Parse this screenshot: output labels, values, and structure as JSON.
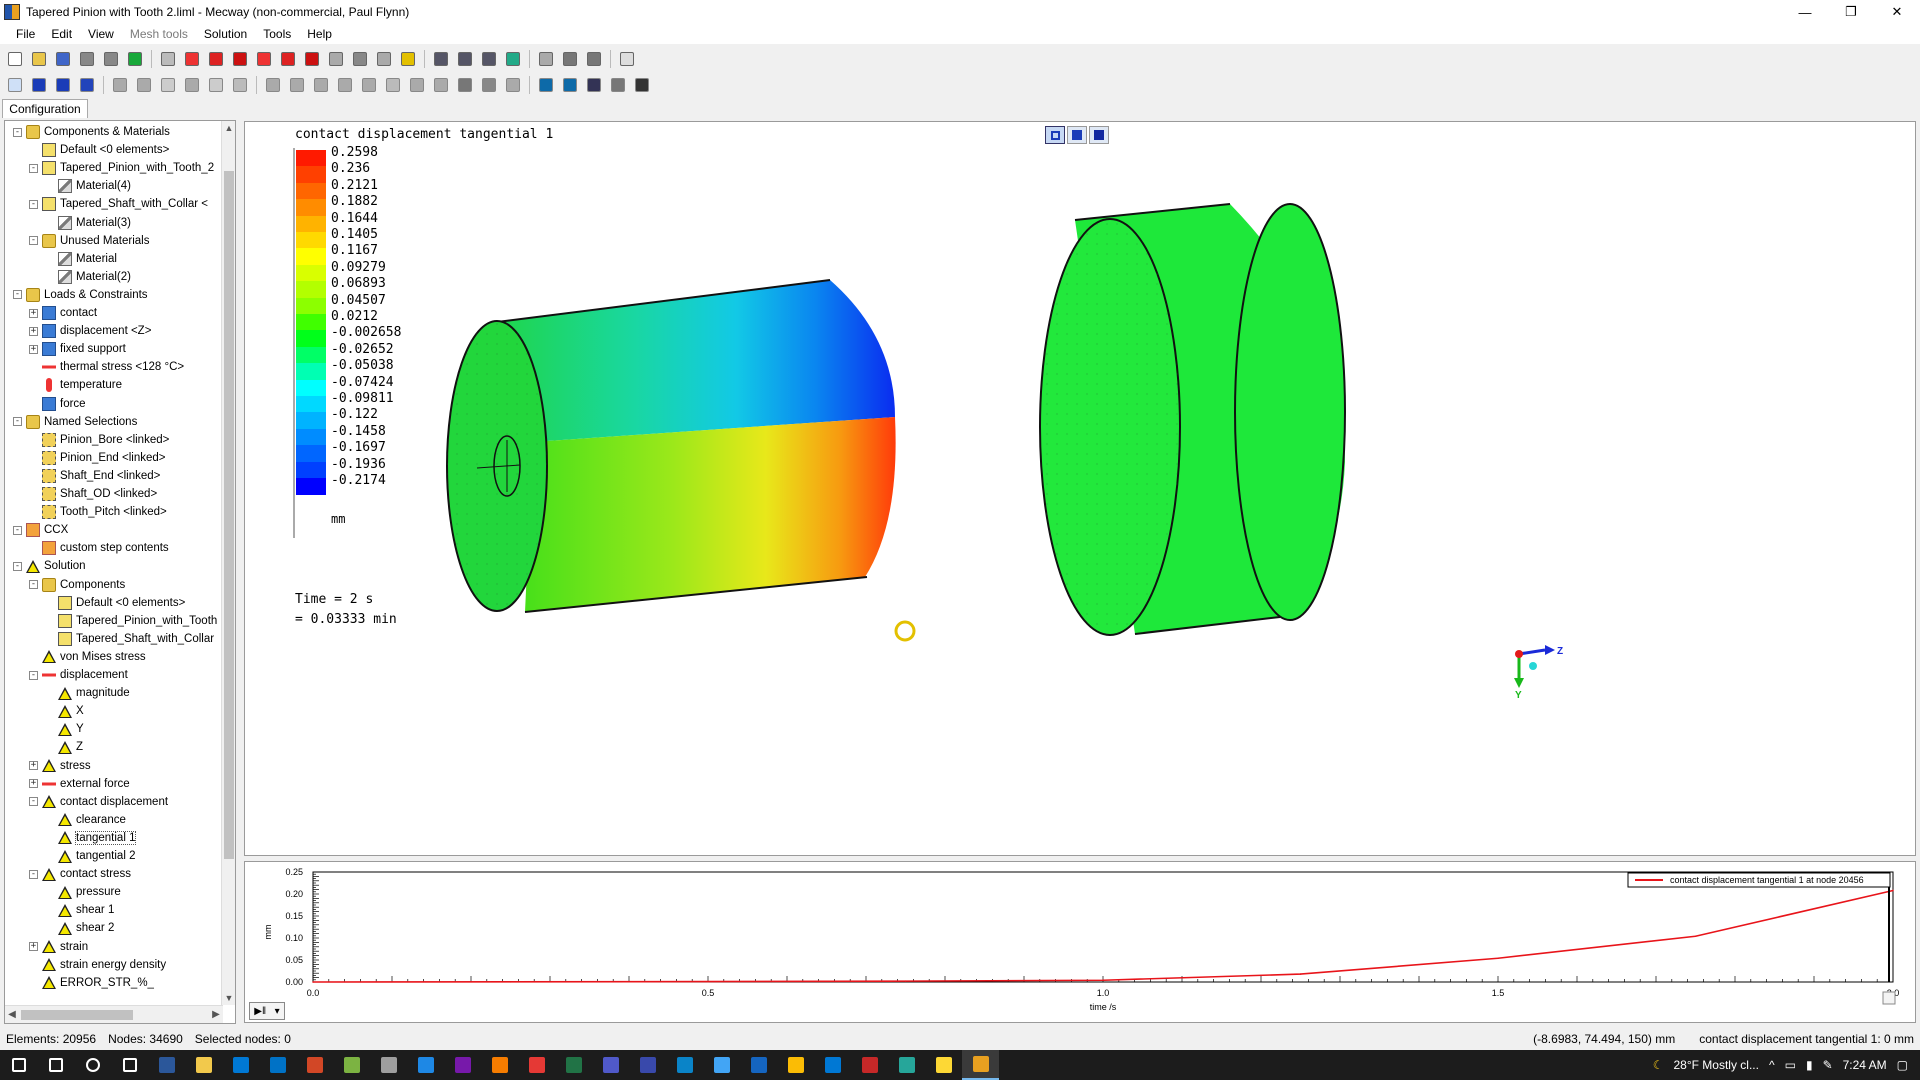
{
  "window": {
    "title": "Tapered Pinion with Tooth 2.liml - Mecway (non-commercial, Paul Flynn)",
    "minimize": "—",
    "maximize": "❐",
    "close": "✕"
  },
  "menu": [
    "File",
    "Edit",
    "View",
    "Mesh tools",
    "Solution",
    "Tools",
    "Help"
  ],
  "menu_disabled": [
    "Mesh tools"
  ],
  "config_tab": "Configuration",
  "tree": [
    {
      "label": "Components & Materials",
      "depth": 0,
      "expander": "-",
      "icon": "folder"
    },
    {
      "label": "Default <0 elements>",
      "depth": 1,
      "expander": "",
      "icon": "comp"
    },
    {
      "label": "Tapered_Pinion_with_Tooth_2",
      "depth": 1,
      "expander": "-",
      "icon": "comp"
    },
    {
      "label": "Material(4)",
      "depth": 2,
      "expander": "",
      "icon": "mat"
    },
    {
      "label": "Tapered_Shaft_with_Collar <",
      "depth": 1,
      "expander": "-",
      "icon": "comp"
    },
    {
      "label": "Material(3)",
      "depth": 2,
      "expander": "",
      "icon": "mat"
    },
    {
      "label": "Unused Materials",
      "depth": 1,
      "expander": "-",
      "icon": "folder"
    },
    {
      "label": "Material",
      "depth": 2,
      "expander": "",
      "icon": "mat"
    },
    {
      "label": "Material(2)",
      "depth": 2,
      "expander": "",
      "icon": "mat"
    },
    {
      "label": "Loads & Constraints",
      "depth": 0,
      "expander": "-",
      "icon": "folder"
    },
    {
      "label": "contact",
      "depth": 1,
      "expander": "+",
      "icon": "load"
    },
    {
      "label": "displacement <Z>",
      "depth": 1,
      "expander": "+",
      "icon": "load"
    },
    {
      "label": "fixed support",
      "depth": 1,
      "expander": "+",
      "icon": "load"
    },
    {
      "label": "thermal stress <128 °C>",
      "depth": 1,
      "expander": "",
      "icon": "arrow"
    },
    {
      "label": "temperature",
      "depth": 1,
      "expander": "",
      "icon": "red"
    },
    {
      "label": "force",
      "depth": 1,
      "expander": "",
      "icon": "load"
    },
    {
      "label": "Named Selections",
      "depth": 0,
      "expander": "-",
      "icon": "folder"
    },
    {
      "label": "Pinion_Bore <linked>",
      "depth": 1,
      "expander": "",
      "icon": "sel"
    },
    {
      "label": "Pinion_End <linked>",
      "depth": 1,
      "expander": "",
      "icon": "sel"
    },
    {
      "label": "Shaft_End <linked>",
      "depth": 1,
      "expander": "",
      "icon": "sel"
    },
    {
      "label": "Shaft_OD <linked>",
      "depth": 1,
      "expander": "",
      "icon": "sel"
    },
    {
      "label": "Tooth_Pitch <linked>",
      "depth": 1,
      "expander": "",
      "icon": "sel"
    },
    {
      "label": "CCX",
      "depth": 0,
      "expander": "-",
      "icon": "ccx"
    },
    {
      "label": "custom step contents",
      "depth": 1,
      "expander": "",
      "icon": "ccx"
    },
    {
      "label": "Solution",
      "depth": 0,
      "expander": "-",
      "icon": "tri"
    },
    {
      "label": "Components",
      "depth": 1,
      "expander": "-",
      "icon": "folder"
    },
    {
      "label": "Default <0 elements>",
      "depth": 2,
      "expander": "",
      "icon": "comp"
    },
    {
      "label": "Tapered_Pinion_with_Tooth",
      "depth": 2,
      "expander": "",
      "icon": "comp"
    },
    {
      "label": "Tapered_Shaft_with_Collar",
      "depth": 2,
      "expander": "",
      "icon": "comp"
    },
    {
      "label": "von Mises stress",
      "depth": 1,
      "expander": "",
      "icon": "tri"
    },
    {
      "label": "displacement",
      "depth": 1,
      "expander": "-",
      "icon": "arrow"
    },
    {
      "label": "magnitude",
      "depth": 2,
      "expander": "",
      "icon": "tri"
    },
    {
      "label": "X",
      "depth": 2,
      "expander": "",
      "icon": "tri"
    },
    {
      "label": "Y",
      "depth": 2,
      "expander": "",
      "icon": "tri"
    },
    {
      "label": "Z",
      "depth": 2,
      "expander": "",
      "icon": "tri"
    },
    {
      "label": "stress",
      "depth": 1,
      "expander": "+",
      "icon": "tri"
    },
    {
      "label": "external force",
      "depth": 1,
      "expander": "+",
      "icon": "arrow"
    },
    {
      "label": "contact displacement",
      "depth": 1,
      "expander": "-",
      "icon": "tri"
    },
    {
      "label": "clearance",
      "depth": 2,
      "expander": "",
      "icon": "tri"
    },
    {
      "label": "tangential 1",
      "depth": 2,
      "expander": "",
      "icon": "tri",
      "selected": true
    },
    {
      "label": "tangential 2",
      "depth": 2,
      "expander": "",
      "icon": "tri"
    },
    {
      "label": "contact stress",
      "depth": 1,
      "expander": "-",
      "icon": "tri"
    },
    {
      "label": "pressure",
      "depth": 2,
      "expander": "",
      "icon": "tri"
    },
    {
      "label": "shear 1",
      "depth": 2,
      "expander": "",
      "icon": "tri"
    },
    {
      "label": "shear 2",
      "depth": 2,
      "expander": "",
      "icon": "tri"
    },
    {
      "label": "strain",
      "depth": 1,
      "expander": "+",
      "icon": "tri"
    },
    {
      "label": "strain energy density",
      "depth": 1,
      "expander": "",
      "icon": "tri"
    },
    {
      "label": "ERROR_STR_%_",
      "depth": 1,
      "expander": "",
      "icon": "tri"
    }
  ],
  "viewport": {
    "title": "contact displacement tangential 1",
    "legend_values": [
      "0.2598",
      "0.236",
      "0.2121",
      "0.1882",
      "0.1644",
      "0.1405",
      "0.1167",
      "0.09279",
      "0.06893",
      "0.04507",
      "0.0212",
      "-0.002658",
      "-0.02652",
      "-0.05038",
      "-0.07424",
      "-0.09811",
      "-0.122",
      "-0.1458",
      "-0.1697",
      "-0.1936",
      "-0.2174"
    ],
    "legend_colors": [
      "#ff1a00",
      "#ff4000",
      "#ff6600",
      "#ff8c00",
      "#ffb300",
      "#ffd900",
      "#ffff00",
      "#d9ff00",
      "#b3ff00",
      "#8cff00",
      "#40ff00",
      "#00ff1a",
      "#00ff66",
      "#00ffb3",
      "#00ffff",
      "#00d9ff",
      "#00b3ff",
      "#008cff",
      "#0066ff",
      "#0040ff",
      "#0000ff"
    ],
    "unit": "mm",
    "time_line1": "Time = 2 s",
    "time_line2": "= 0.03333 min",
    "axis_labels": {
      "x": "Z",
      "y": "Y"
    }
  },
  "graph": {
    "legend": "contact displacement tangential 1 at node 20456",
    "y_label": "mm",
    "x_label": "time /s",
    "y_ticks": [
      "0.25",
      "0.20",
      "0.15",
      "0.10",
      "0.05",
      "0.00"
    ],
    "x_ticks": [
      "0.0",
      "0.5",
      "1.0",
      "1.5",
      "2.0"
    ],
    "series_color": "#e8141a"
  },
  "chart_data": {
    "type": "line",
    "title": "",
    "xlabel": "time /s",
    "ylabel": "mm",
    "xlim": [
      0,
      2
    ],
    "ylim": [
      0,
      0.25
    ],
    "series": [
      {
        "name": "contact displacement tangential 1 at node 20456",
        "x": [
          0.0,
          0.25,
          0.5,
          0.75,
          1.0,
          1.25,
          1.5,
          1.75,
          2.0
        ],
        "y": [
          0.0,
          0.0005,
          0.001,
          0.002,
          0.004,
          0.018,
          0.054,
          0.104,
          0.208
        ]
      }
    ]
  },
  "status": {
    "elements": "Elements: 20956",
    "nodes": "Nodes: 34690",
    "selected": "Selected nodes: 0",
    "coords": "(-8.6983, 74.494, 150) mm",
    "probe": "contact displacement tangential 1: 0 mm"
  },
  "taskbar": {
    "weather": "28°F  Mostly cl...",
    "time": "7:24 AM"
  }
}
